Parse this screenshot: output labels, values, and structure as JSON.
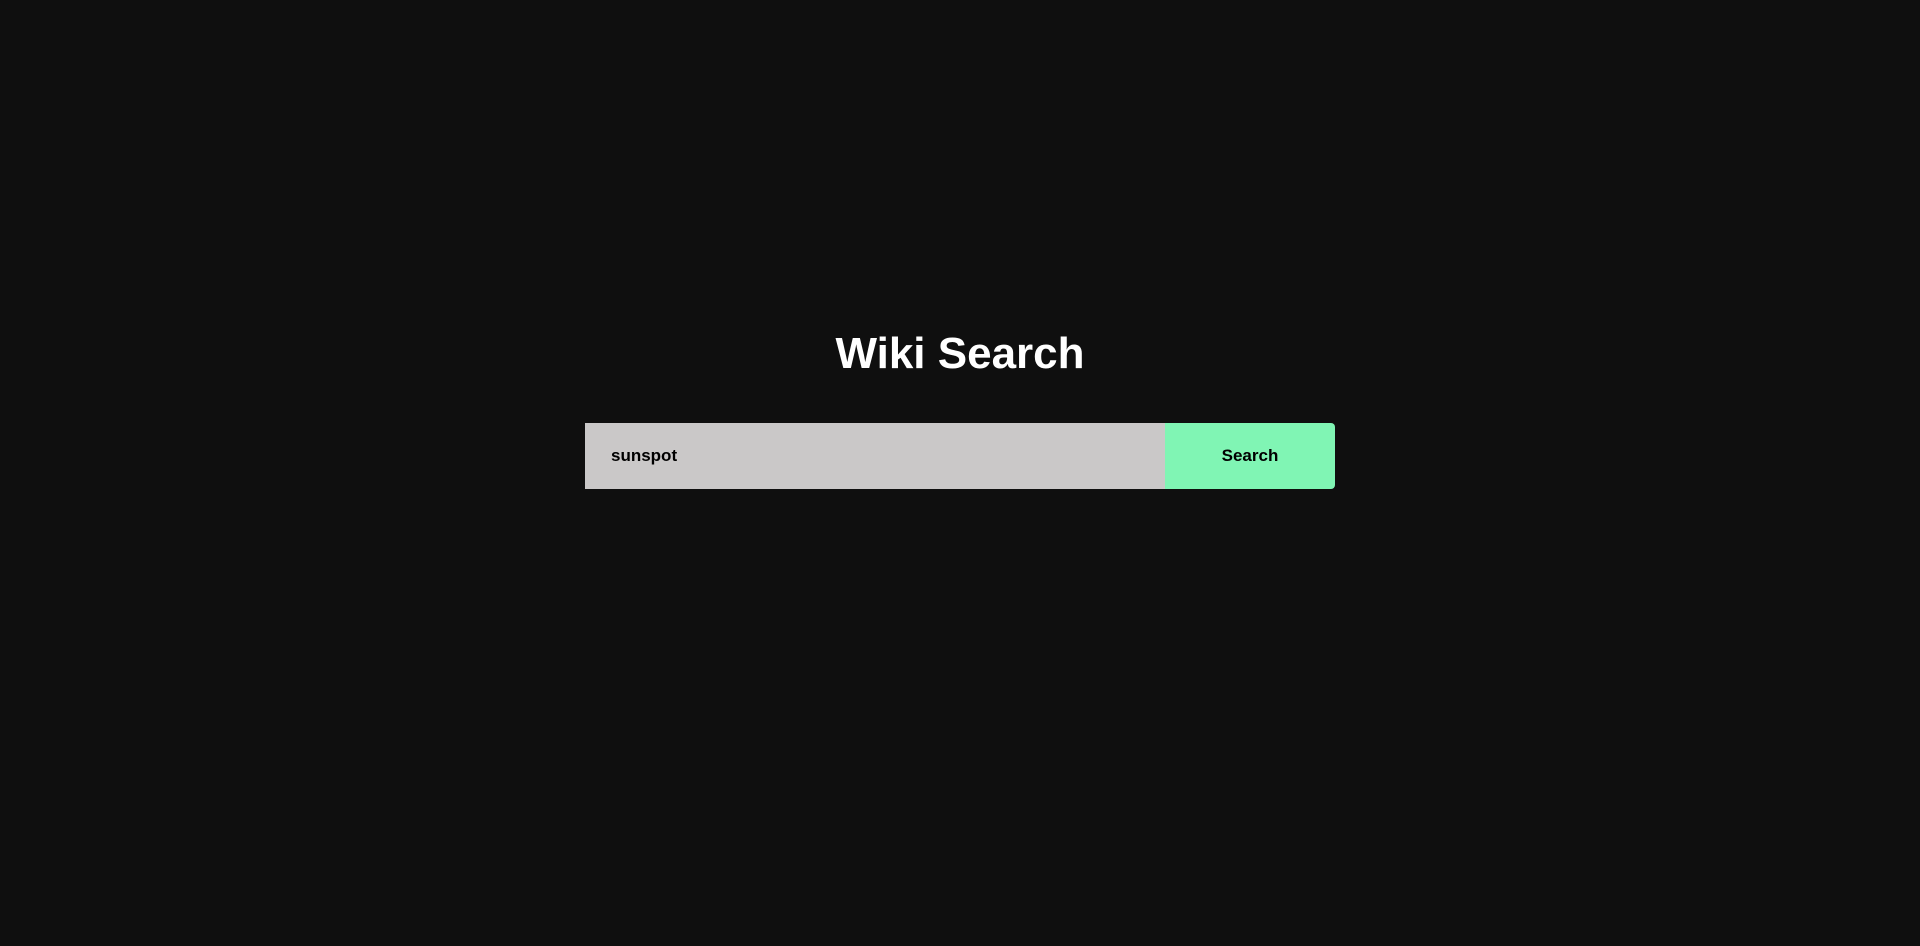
{
  "header": {
    "title": "Wiki Search"
  },
  "search": {
    "value": "sunspot",
    "button_label": "Search"
  },
  "colors": {
    "background": "#0f0f0f",
    "input": "#cac8c8",
    "accent": "#80f5b4"
  }
}
